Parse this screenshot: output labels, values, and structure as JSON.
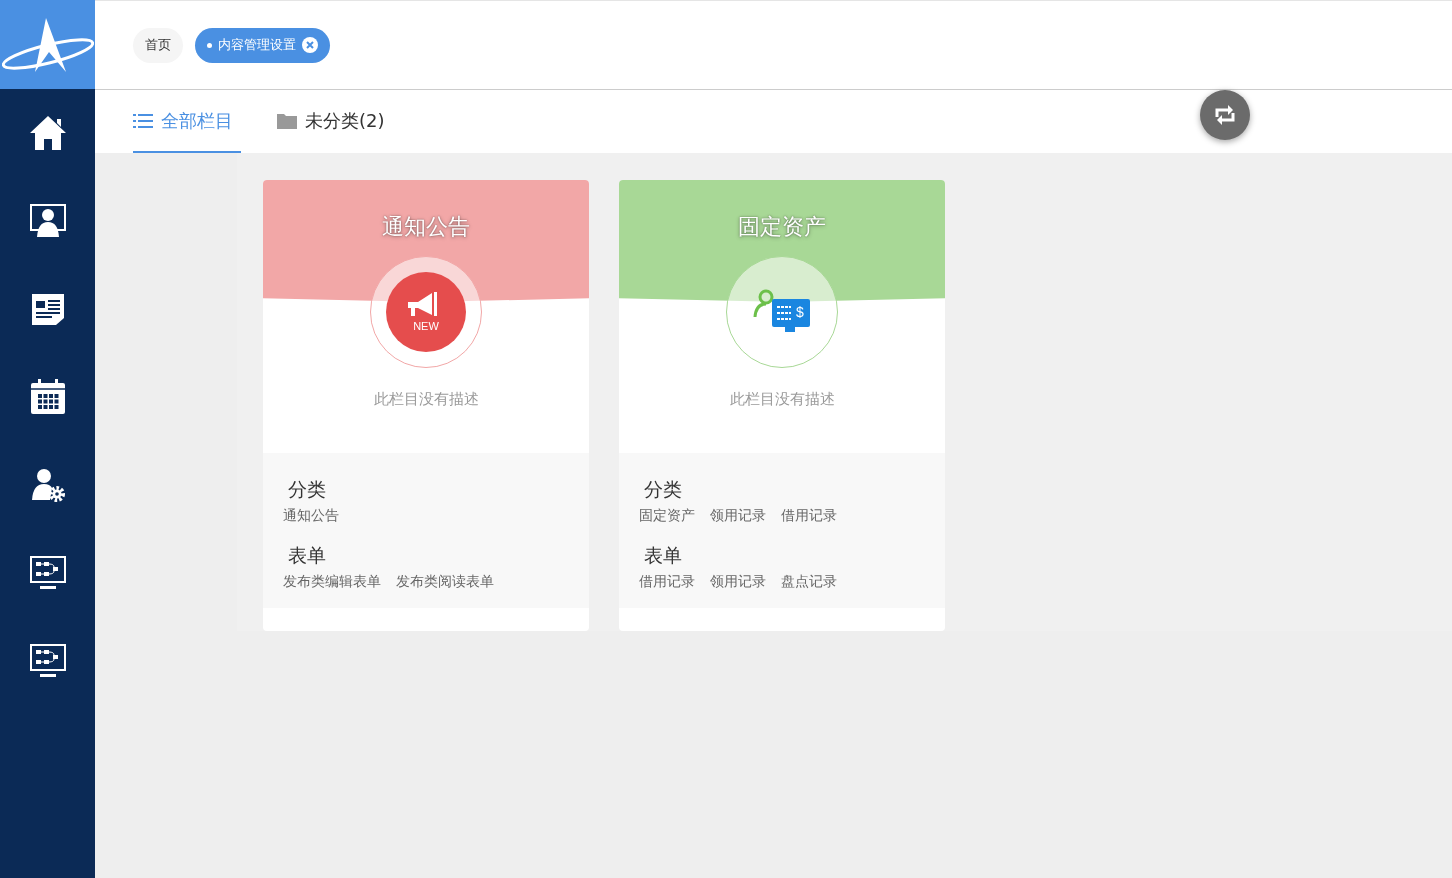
{
  "sidebar": {
    "items": [
      {
        "kind": "home"
      },
      {
        "kind": "monitor-user"
      },
      {
        "kind": "newspaper"
      },
      {
        "kind": "calendar"
      },
      {
        "kind": "user-gear"
      },
      {
        "kind": "flowchart-monitor"
      },
      {
        "kind": "flowchart-monitor"
      }
    ]
  },
  "breadcrumb_tags": [
    {
      "label": "首页",
      "selected": false,
      "closable": false
    },
    {
      "label": "内容管理设置",
      "selected": true,
      "closable": true
    }
  ],
  "tabs": [
    {
      "label": "全部栏目",
      "kind": "list",
      "selected": true
    },
    {
      "label": "未分类(2)",
      "kind": "folder",
      "selected": false
    }
  ],
  "cards": [
    {
      "title": "通知公告",
      "color": "#f2a7a7",
      "kind": "megaphone",
      "icon_text": "NEW",
      "description": "此栏目没有描述",
      "sections": [
        {
          "heading": "分类",
          "links": [
            "通知公告"
          ]
        },
        {
          "heading": "表单",
          "links": [
            "发布类编辑表单",
            "发布类阅读表单"
          ]
        }
      ]
    },
    {
      "title": "固定资产",
      "color": "#a8d896",
      "kind": "user-monitor",
      "icon_text": "$",
      "description": "此栏目没有描述",
      "sections": [
        {
          "heading": "分类",
          "links": [
            "固定资产",
            "领用记录",
            "借用记录"
          ]
        },
        {
          "heading": "表单",
          "links": [
            "借用记录",
            "领用记录",
            "盘点记录"
          ]
        }
      ]
    }
  ]
}
